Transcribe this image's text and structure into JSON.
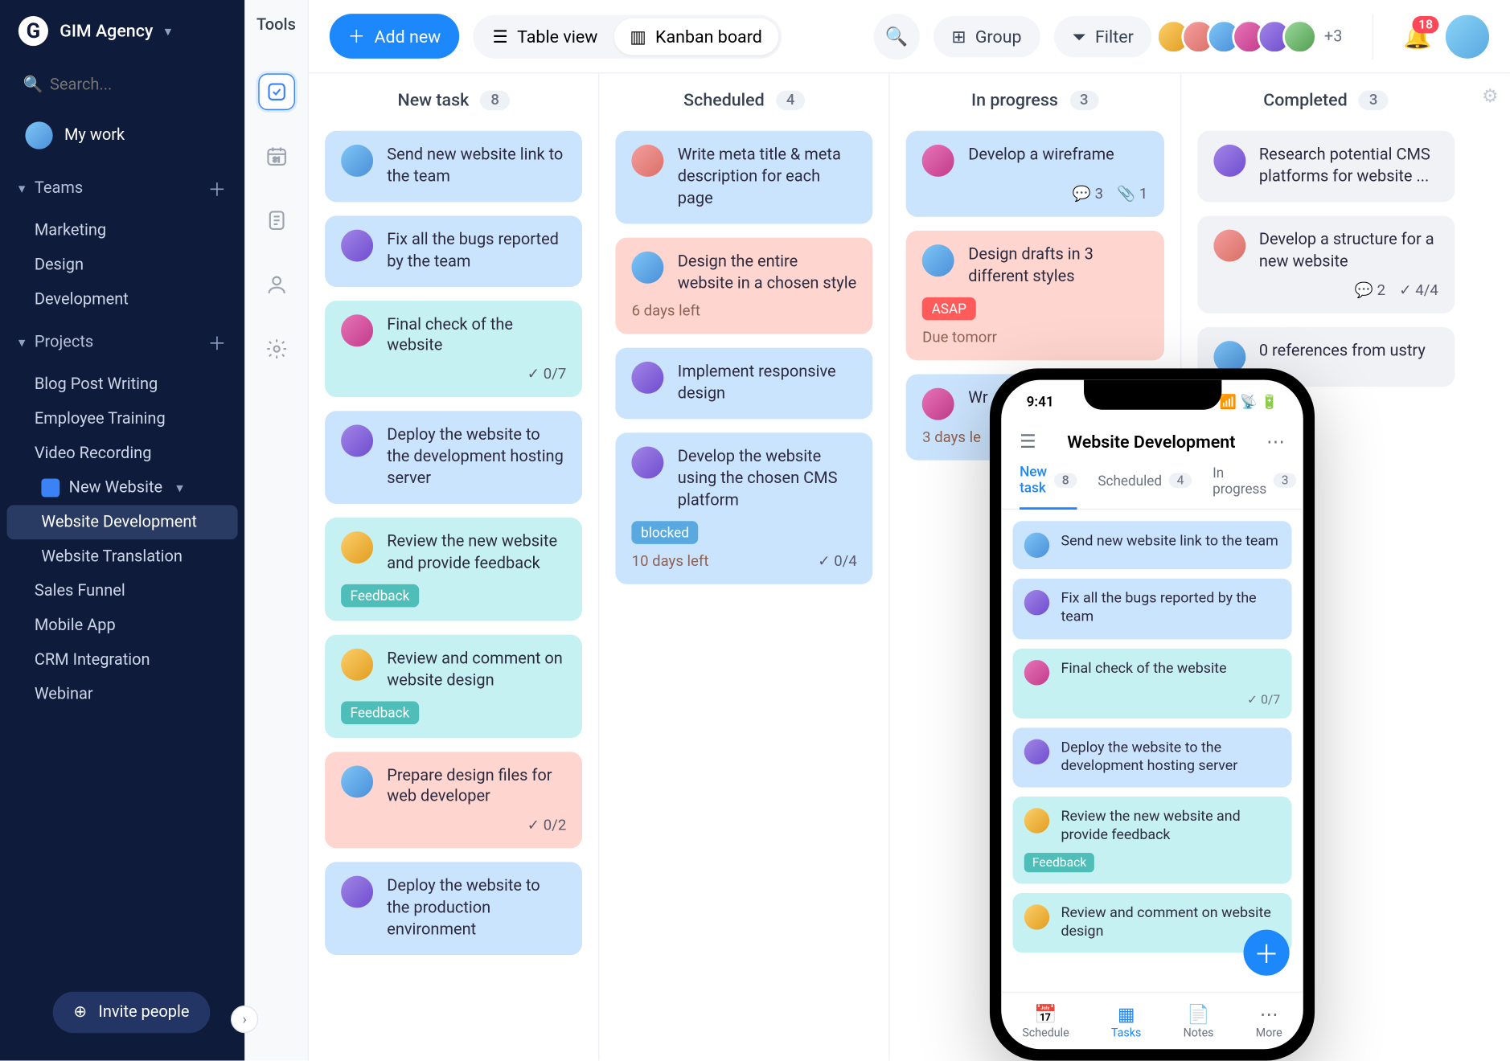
{
  "workspace": {
    "name": "GIM Agency",
    "logo_letter": "G"
  },
  "search": {
    "placeholder": "Search..."
  },
  "mywork": {
    "label": "My work"
  },
  "sidebar": {
    "teams_label": "Teams",
    "teams": [
      "Marketing",
      "Design",
      "Development"
    ],
    "projects_label": "Projects",
    "projects": [
      "Blog Post Writing",
      "Employee Training",
      "Video Recording"
    ],
    "active_folder": "New Website",
    "subpages": [
      "Website Development",
      "Website Translation"
    ],
    "more_projects": [
      "Sales Funnel",
      "Mobile App",
      "CRM Integration",
      "Webinar"
    ],
    "invite_label": "Invite people"
  },
  "rail": {
    "label": "Tools"
  },
  "toolbar": {
    "add_new": "Add new",
    "table_view": "Table view",
    "kanban_board": "Kanban board",
    "group": "Group",
    "filter": "Filter",
    "more_avatars": "+3",
    "notif_count": "18"
  },
  "board": {
    "columns": [
      {
        "title": "New task",
        "count": "8",
        "cards": [
          {
            "color": "blue",
            "av": "av-c2",
            "title": "Send new website link to the team"
          },
          {
            "color": "blue",
            "av": "av-c4",
            "title": "Fix all the bugs reported by the team"
          },
          {
            "color": "cyan",
            "av": "av-c3",
            "title": "Final check of the website",
            "check": "0/7"
          },
          {
            "color": "blue",
            "av": "av-c4",
            "title": "Deploy the website to the development hosting server"
          },
          {
            "color": "cyan",
            "av": "av-c5",
            "title": "Review the new website and provide feedback",
            "tag": "Feedback",
            "tagc": "teal"
          },
          {
            "color": "cyan",
            "av": "av-c5",
            "title": "Review and comment on website design",
            "tag": "Feedback",
            "tagc": "teal"
          },
          {
            "color": "peach",
            "av": "av-c2",
            "title": "Prepare design files for web developer",
            "check": "0/2"
          },
          {
            "color": "blue",
            "av": "av-c4",
            "title": "Deploy the website to the production environment"
          }
        ]
      },
      {
        "title": "Scheduled",
        "count": "4",
        "cards": [
          {
            "color": "blue",
            "av": "av-c1",
            "title": "Write meta title & meta description for each page"
          },
          {
            "color": "peach",
            "av": "av-c2",
            "title": "Design the entire website in a chosen style",
            "due": "6 days left"
          },
          {
            "color": "blue",
            "av": "av-c4",
            "title": "Implement responsive design"
          },
          {
            "color": "blue",
            "av": "av-c4",
            "title": "Develop the website using the chosen CMS platform",
            "tag": "blocked",
            "tagc": "blue",
            "due2": "10 days left",
            "check": "0/4"
          }
        ]
      },
      {
        "title": "In progress",
        "count": "3",
        "cards": [
          {
            "color": "blue",
            "av": "av-c3",
            "title": "Develop a wireframe",
            "comments": "3",
            "attach": "1"
          },
          {
            "color": "peach",
            "av": "av-c2",
            "title": "Design drafts in 3 different styles",
            "tag": "ASAP",
            "tagc": "red",
            "due": "Due tomorr"
          },
          {
            "color": "blue",
            "av": "av-c3",
            "title": "Wr",
            "due": "3 days le"
          }
        ]
      },
      {
        "title": "Completed",
        "count": "3",
        "cards": [
          {
            "color": "grey",
            "av": "av-c4",
            "title": "Research potential CMS platforms for website ..."
          },
          {
            "color": "grey",
            "av": "av-c1",
            "title": "Develop a structure for a new website",
            "comments": "2",
            "check": "4/4"
          },
          {
            "color": "grey",
            "av": "av-c2",
            "title": "0 references from ustry"
          }
        ]
      }
    ]
  },
  "phone": {
    "time": "9:41",
    "title": "Website Development",
    "tabs": [
      {
        "label": "New task",
        "count": "8",
        "active": true
      },
      {
        "label": "Scheduled",
        "count": "4"
      },
      {
        "label": "In progress",
        "count": "3"
      }
    ],
    "cards": [
      {
        "color": "blue",
        "av": "av-c2",
        "title": "Send new website link to the team"
      },
      {
        "color": "blue",
        "av": "av-c4",
        "title": "Fix all the bugs reported by the team"
      },
      {
        "color": "cyan",
        "av": "av-c3",
        "title": "Final check of the website",
        "check": "0/7"
      },
      {
        "color": "blue",
        "av": "av-c4",
        "title": "Deploy the website to the development hosting server"
      },
      {
        "color": "cyan",
        "av": "av-c5",
        "title": "Review the new website and provide feedback",
        "tag": "Feedback"
      },
      {
        "color": "cyan",
        "av": "av-c5",
        "title": "Review and comment on website design"
      }
    ],
    "nav": [
      {
        "label": "Schedule",
        "icon": "📅"
      },
      {
        "label": "Tasks",
        "icon": "▦",
        "active": true
      },
      {
        "label": "Notes",
        "icon": "📄"
      },
      {
        "label": "More",
        "icon": "⋯"
      }
    ]
  }
}
